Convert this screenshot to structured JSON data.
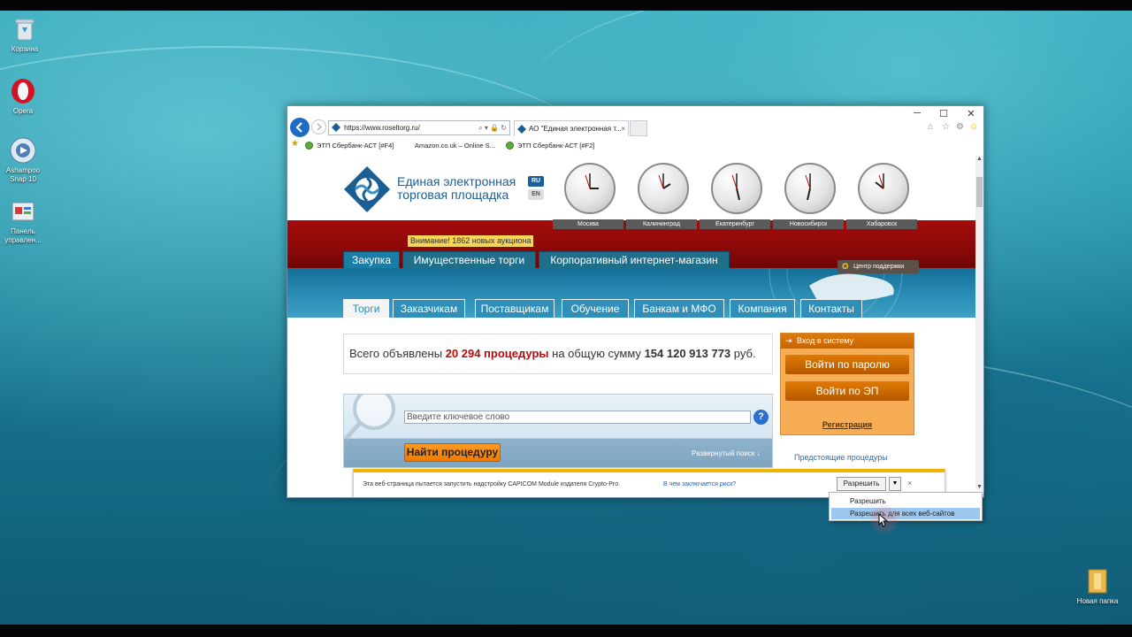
{
  "desktop": {
    "icons": [
      {
        "label": "Корзина"
      },
      {
        "label": "Opera"
      },
      {
        "label": "Ashampoo Snap 10"
      },
      {
        "label": "Панель управлен..."
      },
      {
        "label": "Новая папка"
      }
    ]
  },
  "browser": {
    "url": "https://www.roseltorg.ru/",
    "tab_title": "АО \"Единая электронная т...",
    "favorites": [
      {
        "label": "ЭТП Сбербанк-АСТ [#F4]"
      },
      {
        "label": "Amazon.co.uk – Online S..."
      },
      {
        "label": "ЭТП Сбербанк-АСТ [#F2]"
      }
    ]
  },
  "site": {
    "logo_line1": "Единая электронная",
    "logo_line2": "торговая площадка",
    "lang_ru": "RU",
    "lang_en": "EN",
    "cities": [
      "Москва",
      "Калининград",
      "Екатеринбург",
      "Новосибирск",
      "Хабаровск"
    ],
    "notice": "Внимание! 1862 новых аукциона",
    "main_tabs": [
      {
        "label": "Закупка"
      },
      {
        "label": "Имущественные торги"
      },
      {
        "label": "Корпоративный интернет-магазин"
      }
    ],
    "support": "Центр поддержки",
    "sub_tabs": [
      {
        "label": "Торги"
      },
      {
        "label": "Заказчикам"
      },
      {
        "label": "Поставщикам"
      },
      {
        "label": "Обучение"
      },
      {
        "label": "Банкам и МФО"
      },
      {
        "label": "Компания"
      },
      {
        "label": "Контакты"
      }
    ],
    "stats": {
      "prefix": "Всего объявлены",
      "count": "20 294 процедуры",
      "middle": "на общую сумму",
      "sum": "154 120 913 773",
      "suffix": "руб."
    },
    "search_placeholder": "Введите ключевое слово",
    "help": "?",
    "find_button": "Найти процедуру",
    "extended_search": "Развернутый поиск ↓",
    "login": {
      "title": "Вход в систему",
      "by_password": "Войти по паролю",
      "by_ep": "Войти по ЭП",
      "register": "Регистрация"
    },
    "upcoming": "Предстоящие процедуры"
  },
  "infobar": {
    "message": "Эта веб-страница пытается запустить надстройку CAPICOM Module издателя Crypto-Pro.",
    "risk_link": "В чем заключается риск?",
    "allow_button": "Разрешить",
    "close": "×"
  },
  "dropdown": {
    "items": [
      "Разрешить",
      "Разрешить для всех веб-сайтов"
    ]
  },
  "colors": {
    "brand_blue": "#1a5e93",
    "red_band": "#8c0808",
    "accent_orange": "#f07a00"
  }
}
